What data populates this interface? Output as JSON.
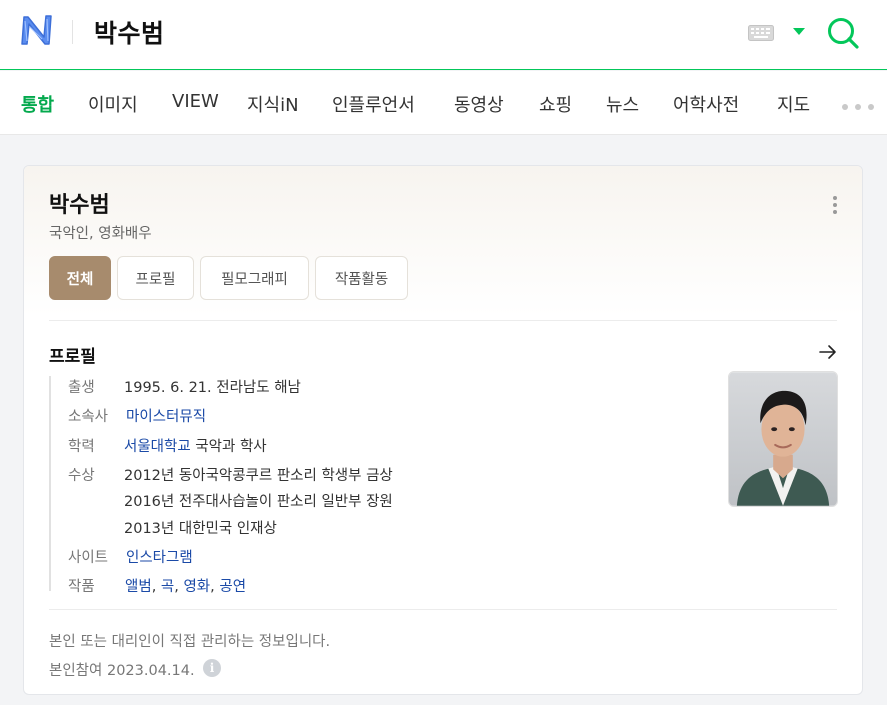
{
  "header": {
    "search_query": "박수범"
  },
  "tabs": [
    {
      "label": "통합",
      "active": true
    },
    {
      "label": "이미지"
    },
    {
      "label": "VIEW"
    },
    {
      "label": "지식iN"
    },
    {
      "label": "인플루언서"
    },
    {
      "label": "동영상"
    },
    {
      "label": "쇼핑"
    },
    {
      "label": "뉴스"
    },
    {
      "label": "어학사전"
    },
    {
      "label": "지도"
    }
  ],
  "profile": {
    "name": "박수범",
    "subtitle": "국악인, 영화배우",
    "segments": [
      {
        "label": "전체",
        "active": true
      },
      {
        "label": "프로필"
      },
      {
        "label": "필모그래피"
      },
      {
        "label": "작품활동"
      }
    ],
    "section_title": "프로필",
    "rows": {
      "birth": {
        "key": "출생",
        "value": "1995. 6. 21. 전라남도 해남"
      },
      "agency": {
        "key": "소속사",
        "value": "마이스터뮤직"
      },
      "education": {
        "key": "학력",
        "school": "서울대학교",
        "rest": " 국악과 학사"
      },
      "awards": {
        "key": "수상",
        "items": [
          "2012년 동아국악콩쿠르 판소리 학생부 금상",
          "2016년 전주대사습놀이 판소리 일반부 장원",
          "2013년 대한민국 인재상"
        ]
      },
      "site": {
        "key": "사이트",
        "value": "인스타그램"
      },
      "works": {
        "key": "작품",
        "items": [
          "앨범",
          "곡",
          "영화",
          "공연"
        ]
      }
    },
    "notice": "본인 또는 대리인이 직접 관리하는 정보입니다.",
    "verified": "본인참여 2023.04.14."
  },
  "colors": {
    "naver_green": "#03c75a",
    "active_segment": "#a78b6d",
    "link": "#1b4aa7"
  },
  "icons": [
    "naver-logo",
    "keyboard-icon",
    "caret-down-icon",
    "search-icon",
    "more-icon",
    "kebab-icon",
    "arrow-right-icon",
    "info-icon"
  ]
}
